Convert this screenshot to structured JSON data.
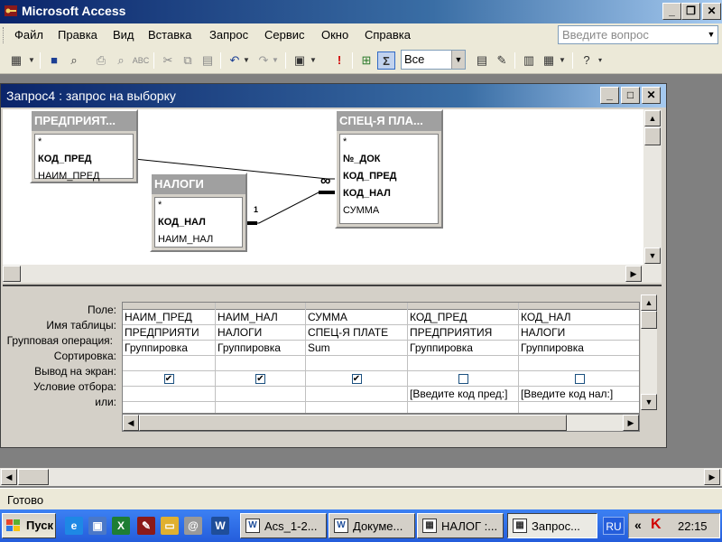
{
  "app": {
    "title": "Microsoft Access",
    "ask_placeholder": "Введите вопрос"
  },
  "menu": [
    "Файл",
    "Правка",
    "Вид",
    "Вставка",
    "Запрос",
    "Сервис",
    "Окно",
    "Справка"
  ],
  "toolbar": {
    "top_values": "Все",
    "icons": [
      "view-icon",
      "save-icon",
      "search-icon",
      "print-icon",
      "print-preview-icon",
      "spelling-icon",
      "cut-icon",
      "copy-icon",
      "paste-icon",
      "undo-icon",
      "redo-icon",
      "query-type-icon",
      "run-icon",
      "show-table-icon",
      "totals-icon",
      "properties-icon",
      "build-icon",
      "database-window-icon",
      "new-object-icon",
      "help-icon"
    ]
  },
  "query_window": {
    "title": "Запрос4 : запрос на выборку"
  },
  "tables": [
    {
      "name": "ПРЕДПРИЯТ...",
      "fields": [
        {
          "label": "*",
          "key": false
        },
        {
          "label": "КОД_ПРЕД",
          "key": true
        },
        {
          "label": "НАИМ_ПРЕД",
          "key": false
        }
      ]
    },
    {
      "name": "НАЛОГИ",
      "fields": [
        {
          "label": "*",
          "key": false
        },
        {
          "label": "КОД_НАЛ",
          "key": true
        },
        {
          "label": "НАИМ_НАЛ",
          "key": false
        }
      ]
    },
    {
      "name": "СПЕЦ-Я ПЛА...",
      "fields": [
        {
          "label": "*",
          "key": false
        },
        {
          "label": "№_ДОК",
          "key": true
        },
        {
          "label": "КОД_ПРЕД",
          "key": true
        },
        {
          "label": "КОД_НАЛ",
          "key": true
        },
        {
          "label": "СУММА",
          "key": false
        }
      ]
    }
  ],
  "relations": {
    "one": "1",
    "many": "∞"
  },
  "grid": {
    "row_labels": [
      "Поле:",
      "Имя таблицы:",
      "Групповая операция:",
      "Сортировка:",
      "Вывод на экран:",
      "Условие отбора:",
      "или:"
    ],
    "columns": [
      {
        "field": "НАИМ_ПРЕД",
        "table": "ПРЕДПРИЯТИ",
        "total": "Группировка",
        "sort": "",
        "show": true,
        "criteria": "",
        "or": ""
      },
      {
        "field": "НАИМ_НАЛ",
        "table": "НАЛОГИ",
        "total": "Группировка",
        "sort": "",
        "show": true,
        "criteria": "",
        "or": ""
      },
      {
        "field": "СУММА",
        "table": "СПЕЦ-Я ПЛАТЕ",
        "total": "Sum",
        "sort": "",
        "show": true,
        "criteria": "",
        "or": ""
      },
      {
        "field": "КОД_ПРЕД",
        "table": "ПРЕДПРИЯТИЯ",
        "total": "Группировка",
        "sort": "",
        "show": false,
        "criteria": "[Введите код пред:]",
        "or": ""
      },
      {
        "field": "КОД_НАЛ",
        "table": "НАЛОГИ",
        "total": "Группировка",
        "sort": "",
        "show": false,
        "criteria": "[Введите код нал:]",
        "or": ""
      }
    ]
  },
  "status": {
    "text": "Готово"
  },
  "taskbar": {
    "start": "Пуск",
    "tasks": [
      {
        "label": "Acs_1-2...",
        "icon": "W",
        "active": false
      },
      {
        "label": "Докуме...",
        "icon": "W",
        "active": false
      },
      {
        "label": "НАЛОГ :...",
        "icon": "▦",
        "active": false
      },
      {
        "label": "Запрос...",
        "icon": "▦",
        "active": true
      }
    ],
    "lang": "RU",
    "clock": "22:15",
    "tray_chevron": "«"
  }
}
